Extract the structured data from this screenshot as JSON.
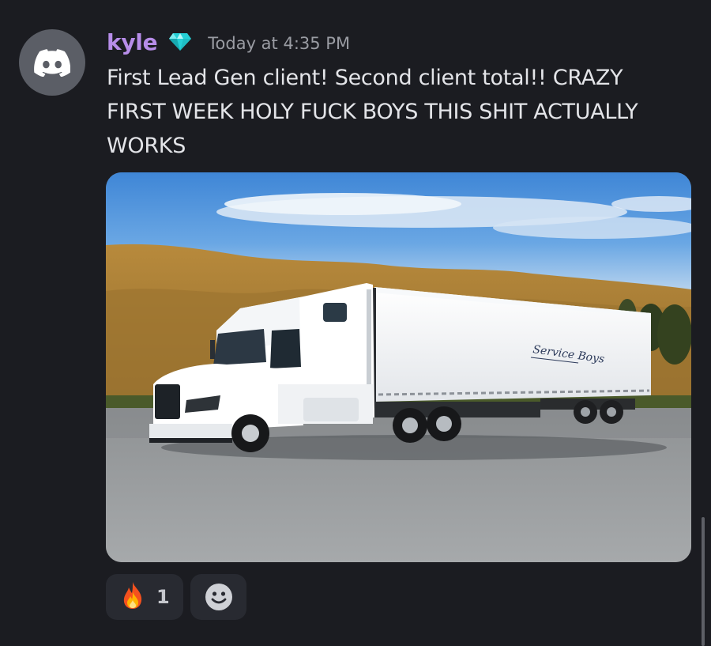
{
  "message": {
    "author": "kyle",
    "author_color": "#b78de9",
    "badge_icon": "diamond-icon",
    "timestamp": "Today at 4:35 PM",
    "avatar_icon": "discord-logo-icon",
    "text": "First Lead Gen client! Second client total!! CRAZY FIRST WEEK HOLY FUCK BOYS THIS SHIT ACTUALLY WORKS",
    "attachment": {
      "type": "image",
      "subject": "white semi truck with trailer in parking lot",
      "trailer_text": "Service Boys"
    }
  },
  "reactions": [
    {
      "emoji": "🔥",
      "icon": "fire-icon",
      "count": "1"
    },
    {
      "icon": "add-reaction-icon"
    }
  ]
}
